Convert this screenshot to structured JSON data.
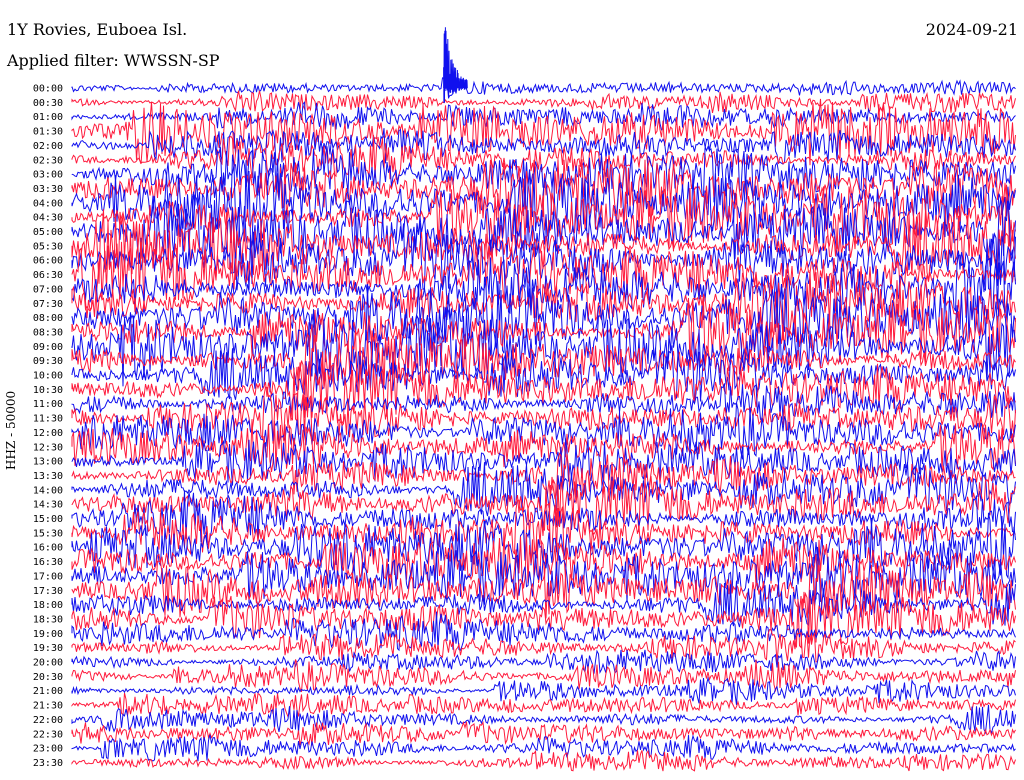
{
  "header": {
    "station": "1Y Rovies, Euboea Isl.",
    "filter": "Applied filter: WWSSN-SP",
    "date": "2024-09-21",
    "channel": "HHZ - 50000"
  },
  "colors": {
    "trace_a": "#ff1a3c",
    "trace_b": "#1010ee",
    "background": "#ffffff"
  },
  "chart_data": {
    "type": "line",
    "title": "1Y Rovies, Euboea Isl.",
    "subtitle": "Applied filter: WWSSN-SP",
    "ylabel": "HHZ - 50000",
    "xlabel": "",
    "row_labels": [
      "00:00",
      "00:30",
      "01:00",
      "01:30",
      "02:00",
      "02:30",
      "03:00",
      "03:30",
      "04:00",
      "04:30",
      "05:00",
      "05:30",
      "06:00",
      "06:30",
      "07:00",
      "07:30",
      "08:00",
      "08:30",
      "09:00",
      "09:30",
      "10:00",
      "10:30",
      "11:00",
      "11:30",
      "12:00",
      "12:30",
      "13:00",
      "13:30",
      "14:00",
      "14:30",
      "15:00",
      "15:30",
      "16:00",
      "16:30",
      "17:00",
      "17:30",
      "18:00",
      "18:30",
      "19:00",
      "19:30",
      "20:00",
      "20:30",
      "21:00",
      "21:30",
      "22:00",
      "22:30",
      "23:00",
      "23:30"
    ],
    "row_colors_cycle": [
      "blue",
      "red"
    ],
    "relative_amplitude": [
      0.25,
      0.35,
      0.4,
      0.9,
      0.5,
      0.7,
      0.95,
      1.0,
      1.0,
      1.0,
      1.0,
      1.0,
      1.0,
      1.0,
      1.0,
      1.0,
      1.0,
      1.0,
      1.0,
      0.9,
      0.8,
      0.8,
      0.75,
      0.8,
      0.7,
      0.7,
      0.6,
      0.6,
      0.75,
      0.75,
      0.8,
      0.8,
      0.85,
      0.85,
      0.8,
      0.8,
      0.7,
      0.7,
      0.6,
      0.5,
      0.4,
      0.4,
      0.35,
      0.35,
      0.35,
      0.4,
      0.35,
      0.4
    ],
    "events": [
      {
        "time": "00:00",
        "x_fraction": 0.4
      }
    ]
  }
}
